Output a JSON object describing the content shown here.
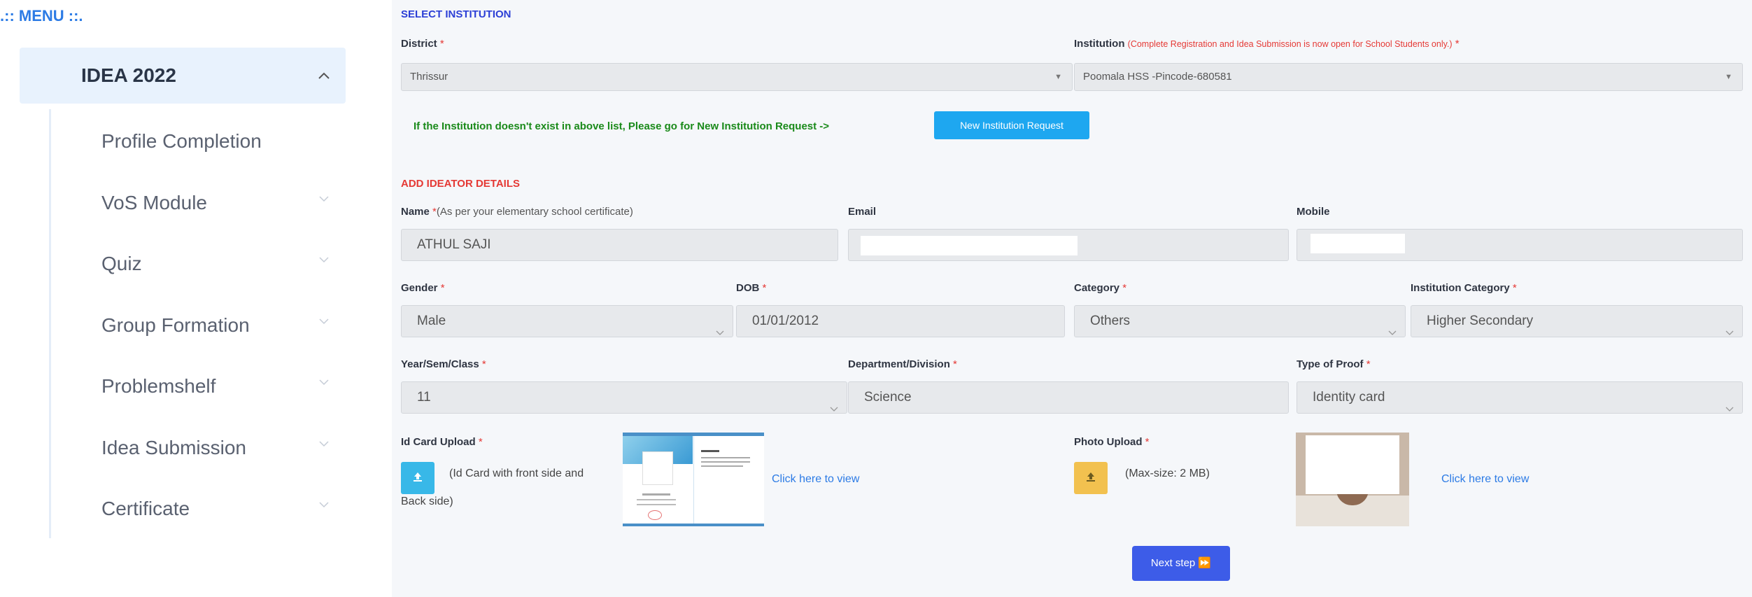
{
  "sidebar": {
    "menu_title": ".:: MENU ::.",
    "group": {
      "label": "IDEA 2022",
      "expanded": true
    },
    "items": [
      {
        "label": "Profile Completion",
        "has_chevron": false
      },
      {
        "label": "VoS Module",
        "has_chevron": true
      },
      {
        "label": "Quiz",
        "has_chevron": true
      },
      {
        "label": "Group Formation",
        "has_chevron": true
      },
      {
        "label": "Problemshelf",
        "has_chevron": true
      },
      {
        "label": "Idea Submission",
        "has_chevron": true
      },
      {
        "label": "Certificate",
        "has_chevron": true
      }
    ]
  },
  "institution": {
    "section_title": "SELECT INSTITUTION",
    "district_label": "District",
    "district_value": "Thrissur",
    "institution_label": "Institution",
    "institution_hint": "(Complete Registration and Idea Submission is now open for School Students only.)",
    "institution_value": "Poomala HSS -Pincode-680581",
    "note": "If the Institution doesn't exist in above list, Please go for New Institution Request ->",
    "new_request_button": "New Institution Request"
  },
  "ideator": {
    "section_title": "ADD IDEATOR DETAILS",
    "name_label": "Name",
    "name_hint": "(As per your elementary school certificate)",
    "name_value": "ATHUL SAJI",
    "email_label": "Email",
    "email_value": "",
    "mobile_label": "Mobile",
    "mobile_value": "",
    "gender_label": "Gender",
    "gender_value": "Male",
    "dob_label": "DOB",
    "dob_value": "01/01/2012",
    "category_label": "Category",
    "category_value": "Others",
    "inst_category_label": "Institution Category",
    "inst_category_value": "Higher Secondary",
    "year_label": "Year/Sem/Class",
    "year_value": "11",
    "department_label": "Department/Division",
    "department_value": "Science",
    "proof_label": "Type of Proof",
    "proof_value": "Identity card",
    "idcard_label": "Id Card Upload",
    "idcard_hint_line1": "(Id Card with front side and",
    "idcard_hint_line2": "Back side)",
    "idcard_view_link": "Click here to view",
    "photo_label": "Photo Upload",
    "photo_hint": "(Max-size: 2 MB)",
    "photo_view_link": "Click here to view",
    "required_mark": "*",
    "next_button": "Next step ⏩"
  },
  "colors": {
    "accent_blue": "#2c7be5",
    "section_blue": "#2c3fd6",
    "required_red": "#e53935",
    "note_green": "#1a8a1a",
    "cyan_button": "#1ea7f0",
    "next_button": "#3d5ce8",
    "upload_blue": "#38b8e8",
    "upload_yellow": "#f2c14f"
  },
  "icons": {
    "group_chevron": "chevron-up-icon",
    "item_chevron": "chevron-down-icon",
    "upload": "upload-icon",
    "select_caret": "caret-down-icon"
  }
}
